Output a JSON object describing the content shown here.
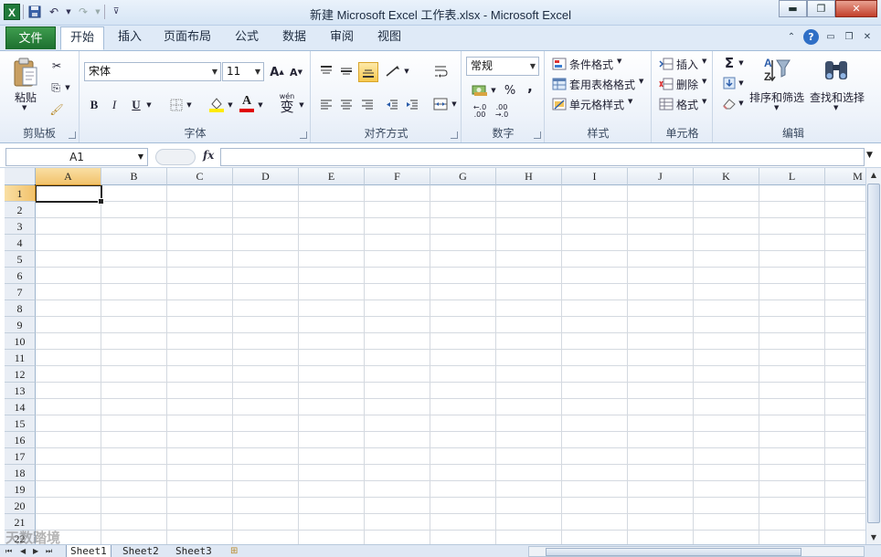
{
  "window": {
    "title": "新建 Microsoft Excel 工作表.xlsx - Microsoft Excel",
    "app_icon": "X"
  },
  "ribbon_tabs": {
    "file": "文件",
    "items": [
      "开始",
      "插入",
      "页面布局",
      "公式",
      "数据",
      "审阅",
      "视图"
    ]
  },
  "clipboard": {
    "paste": "粘贴",
    "label": "剪贴板"
  },
  "font": {
    "name": "宋体",
    "size": "11",
    "grow": "A",
    "shrink": "A",
    "bold": "B",
    "italic": "I",
    "underline": "U",
    "phonetic": "wén",
    "phonetic_char": "变",
    "color_letter": "A",
    "label": "字体"
  },
  "alignment": {
    "label": "对齐方式"
  },
  "number": {
    "format": "常规",
    "percent": "%",
    "comma": ",",
    "inc_decimal_top": "←.0",
    "inc_decimal_bottom": ".00",
    "dec_decimal_top": ".00",
    "dec_decimal_bottom": "→.0",
    "label": "数字"
  },
  "styles": {
    "conditional": "条件格式",
    "table": "套用表格格式",
    "cell": "单元格样式",
    "label": "样式"
  },
  "cells": {
    "insert": "插入",
    "delete": "删除",
    "format": "格式",
    "label": "单元格"
  },
  "editing": {
    "sort": "排序和筛选",
    "find": "查找和选择",
    "sigma": "Σ",
    "label": "编辑"
  },
  "formula_bar": {
    "name_box": "A1",
    "fx": "fx",
    "value": ""
  },
  "grid": {
    "columns": [
      "A",
      "B",
      "C",
      "D",
      "E",
      "F",
      "G",
      "H",
      "I",
      "J",
      "K",
      "L",
      "M"
    ],
    "rows": [
      "1",
      "2",
      "3",
      "4",
      "5",
      "6",
      "7",
      "8",
      "9",
      "10",
      "11",
      "12",
      "13",
      "14",
      "15",
      "16",
      "17",
      "18",
      "19",
      "20",
      "21",
      "22"
    ],
    "active_cell": "A1"
  },
  "sheets": [
    "Sheet1",
    "Sheet2",
    "Sheet3"
  ],
  "watermark": "天数踏境"
}
